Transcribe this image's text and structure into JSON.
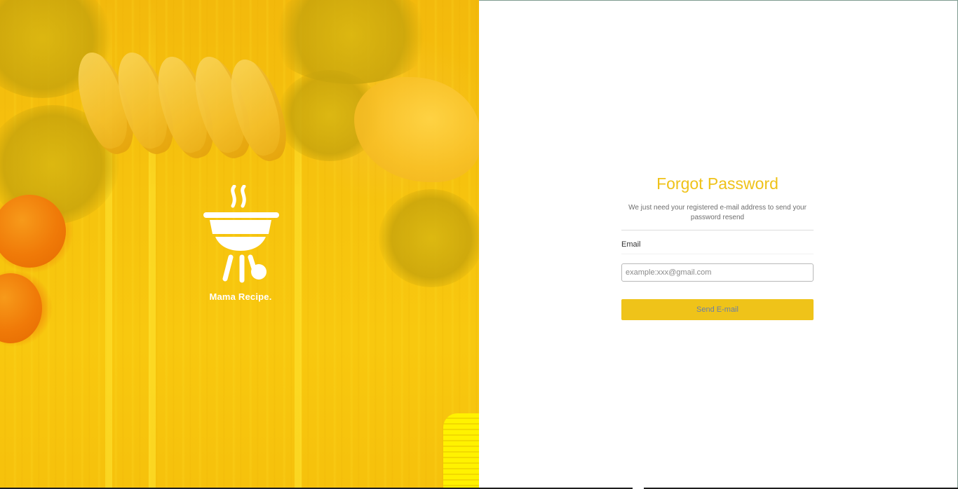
{
  "hero": {
    "brand_name": "Mama Recipe.",
    "logo_icon": "barbecue-grill-icon"
  },
  "form": {
    "title": "Forgot Password",
    "subtitle": "We just need your registered e-mail address to send your password resend",
    "email_label": "Email",
    "email_placeholder": "example:xxx@gmail.com",
    "email_value": "",
    "submit_label": "Send E-mail"
  },
  "colors": {
    "accent": "#efc319",
    "title": "#efc219",
    "hero_base": "#f6c30e",
    "button_text": "#6a7fa8"
  }
}
